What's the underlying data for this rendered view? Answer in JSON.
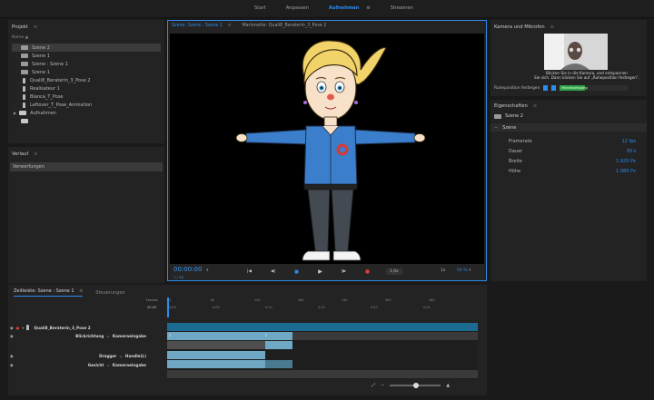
{
  "menu": {
    "items": [
      "Start",
      "Anpassen",
      "Aufnehmen",
      "Streamen"
    ],
    "active_index": 2,
    "active_marker": "≡"
  },
  "project": {
    "title": "Projekt",
    "menu_glyph": "≡",
    "col_name": "Name ▲",
    "items": [
      {
        "icon": "scene-icon",
        "label": "Szene 2"
      },
      {
        "icon": "scene-icon",
        "label": "Szene 1"
      },
      {
        "icon": "scene-icon",
        "label": "Szene : Szene 1"
      },
      {
        "icon": "scene-icon",
        "label": "Szene 1"
      },
      {
        "icon": "puppet-icon",
        "label": "Quali8_Beraterin_3_Pose 2"
      },
      {
        "icon": "puppet-icon",
        "label": "Realisateur 1"
      },
      {
        "icon": "puppet-icon",
        "label": "Blanca_T_Pose"
      },
      {
        "icon": "puppet-icon",
        "label": "Leftover_T_Pose_Animation"
      },
      {
        "icon": "folder-icon",
        "label": "Aufnahmen"
      }
    ]
  },
  "history": {
    "title": "Verlauf",
    "menu_glyph": "≡",
    "item": "Verwerfungen"
  },
  "scene_tabs": [
    {
      "label": "Szene: Szene : Szene 1",
      "active": true,
      "menu": "≡"
    },
    {
      "label": "Marionette: Quali8_Beraterin_3_Pose 2",
      "active": false
    }
  ],
  "transport": {
    "timecode": "00:00:00",
    "frame": "1 / 30",
    "dropdown": "▾",
    "icons": [
      "go-start-icon",
      "step-back-icon",
      "record-mode-icon",
      "play-icon",
      "step-forward-icon",
      "record-icon"
    ],
    "glyphs": [
      "|◀",
      "◀|",
      "■",
      "▶",
      "|▶",
      "●"
    ],
    "speed": "1,0x",
    "fit": "1x",
    "zoom": "50 %"
  },
  "camera": {
    "title": "Kamera und Mikrofon",
    "menu_glyph": "≡",
    "message_line1": "Blicken Sie in die Kamera, und entspannen",
    "message_line2": "Sie sich. Dann klicken Sie auf „Ruheposition festlegen“.",
    "rest_pose_label": "Ruheposition festlegen",
    "mic_level": "Mikrofoneingang"
  },
  "properties": {
    "title": "Eigenschaften",
    "menu_glyph": "≡",
    "scene_name": "Szene 2",
    "section": "Szene",
    "rows": [
      {
        "label": "Framerate",
        "value": "12 fps"
      },
      {
        "label": "Dauer",
        "value": "30 s"
      },
      {
        "label": "Breite",
        "value": "1.920 Px"
      },
      {
        "label": "Höhe",
        "value": "1.080 Px"
      }
    ]
  },
  "timeline": {
    "tabs": [
      {
        "label": "Zeitleiste: Szene : Szene 1",
        "active": true,
        "menu": "≡"
      },
      {
        "label": "Steuerungen",
        "active": false
      }
    ],
    "frames_label": "Frames",
    "time_label": "00:00",
    "ruler_frames": [
      "0",
      "60",
      "120",
      "180",
      "240",
      "300",
      "360"
    ],
    "ruler_times": [
      "0:00",
      "0:05",
      "0:10",
      "0:15",
      "0:20",
      "0:25"
    ],
    "track_rows": [
      {
        "name": "Quali8_Beraterin_3_Pose 2",
        "sub": ""
      },
      {
        "name": "Blickrichtung",
        "sub": "Kameraeingabe"
      },
      {
        "name": "Dragger",
        "sub": "Handle(L)"
      },
      {
        "name": "Gesicht",
        "sub": "Kameraeingabe"
      }
    ],
    "separator": "=",
    "clip_marks": [
      "1",
      "2"
    ]
  },
  "colors": {
    "accent": "#2d8ceb",
    "clip": "#6fa8c4",
    "clip_dark": "#4a7a8f",
    "track_bar": "#1c6b93"
  }
}
